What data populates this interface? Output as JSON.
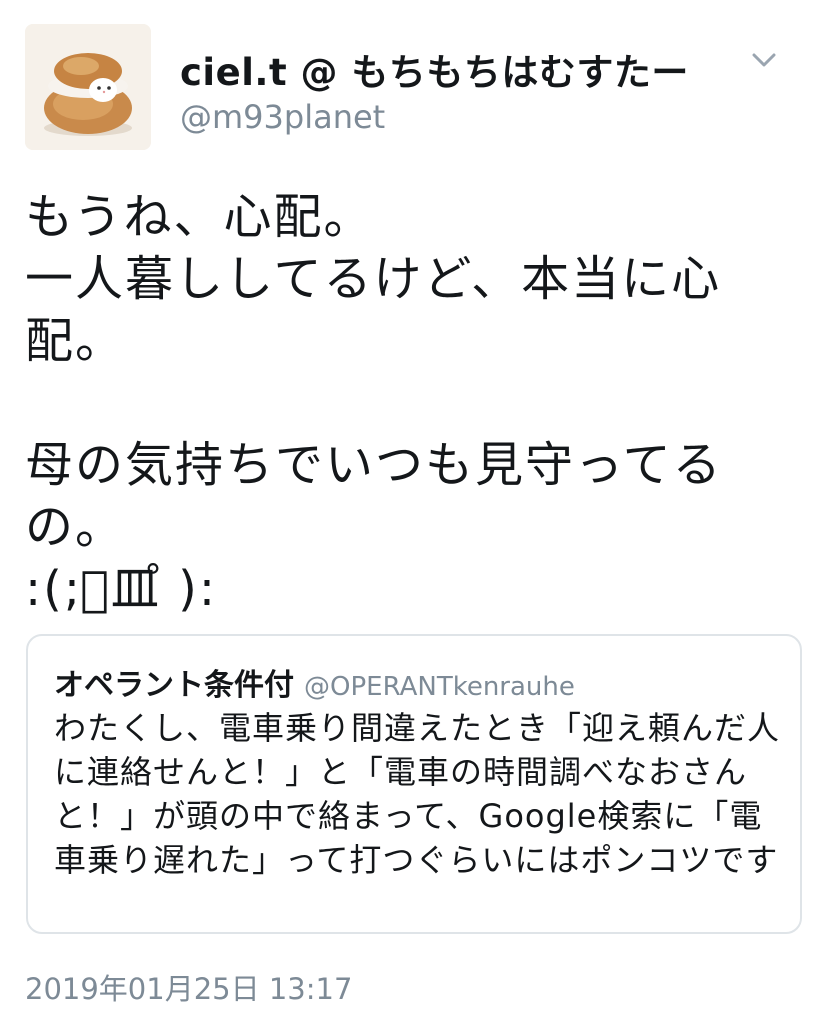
{
  "user": {
    "display_name": "ciel.t @ もちもちはむすたー",
    "handle": "@m93planet",
    "avatar_icon": "cream-puff-avatar-icon"
  },
  "menu": {
    "icon": "chevron-down-icon"
  },
  "tweet": {
    "text": "もうね、心配。\n一人暮ししてるけど、本当に心配。\n\n母の気持ちでいつも見守ってるの。\n:(;゚皿゚ ):"
  },
  "quoted_tweet": {
    "author_name": "オペラント条件付",
    "author_handle": "@OPERANTkenrauhe",
    "text": "わたくし、電車乗り間違えたとき「迎え頼んだ人に連絡せんと！」と「電車の時間調べなおさんと！」が頭の中で絡まって、Google検索に「電車乗り遅れた」って打つぐらいにはポンコツです"
  },
  "timestamp": "2019年01月25日 13:17",
  "colors": {
    "text_primary": "#14171a",
    "text_secondary": "#7d8a96",
    "card_border": "#dfe4e8",
    "chevron": "#9aa5b0"
  }
}
